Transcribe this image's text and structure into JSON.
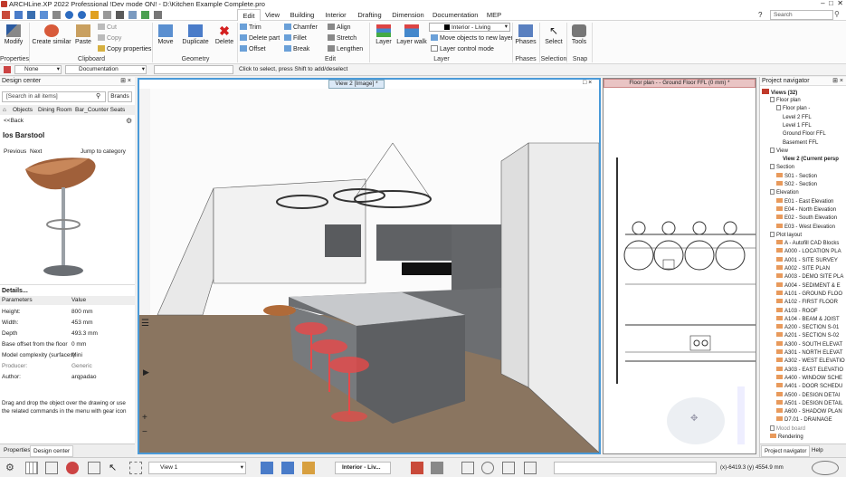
{
  "title": "ARCHLine.XP 2022  Professional !Dev mode ON! - D:\\Kitchen Example Complete.pro",
  "menu": [
    "Edit",
    "View",
    "Building",
    "Interior",
    "Drafting",
    "Dimension",
    "Documentation",
    "MEP"
  ],
  "search_placeholder": "Search",
  "ribbon": {
    "modify": "Modify",
    "create_similar": "Create similar",
    "paste": "Paste",
    "cut": "Cut",
    "copy": "Copy",
    "copy_properties": "Copy properties",
    "move": "Move",
    "duplicate": "Duplicate",
    "delete": "Delete",
    "trim": "Trim",
    "delete_part": "Delete part",
    "offset": "Offset",
    "chamfer": "Chamfer",
    "fillet": "Fillet",
    "break": "Break",
    "align": "Align",
    "stretch": "Stretch",
    "lengthen": "Lengthen",
    "layer": "Layer",
    "layer_walk": "Layer walk",
    "layer_value": "Interior - Living",
    "move_objects": "Move objects to new layer",
    "layer_control": "Layer control mode",
    "phases": "Phases",
    "select": "Select",
    "tools": "Tools",
    "groups": [
      "Properties",
      "Clipboard",
      "Geometry",
      "Edit",
      "Layer",
      "Phases",
      "Selection",
      "Snap"
    ]
  },
  "toolbar2": {
    "line_style": "None",
    "layer": "Documentation",
    "hint": "Click to select, press Shift to add/deselect"
  },
  "design_center": {
    "title": "Design center",
    "search": "[Search in all items]",
    "brands": "Brands",
    "breadcrumb": [
      "Objects",
      "Dining Room",
      "Bar_Counter Seats"
    ],
    "back": "<<Back",
    "item_title": "Ios Barstool",
    "previous": "Previous",
    "next": "Next",
    "jump": "Jump to category",
    "details": "Details...",
    "params_header": [
      "Parameters",
      "Value"
    ],
    "params": [
      [
        "Height:",
        "800 mm"
      ],
      [
        "Width:",
        "453 mm"
      ],
      [
        "Depth",
        "493.3 mm"
      ],
      [
        "Base offset from the floor",
        "0 mm"
      ],
      [
        "Model complexity (surfaces)",
        "Mini"
      ],
      [
        "Producer:",
        "Generic"
      ],
      [
        "Author:",
        "arqpadao"
      ]
    ],
    "help": "Drag and drop the object over the drawing or use the related commands in the menu with gear icon",
    "tabs": [
      "Properties",
      "Design center"
    ]
  },
  "view2_tab": "View 2 [Image] *",
  "floorplan_tab": "Floor plan - - Ground Floor FFL (0 mm) *",
  "navigator": {
    "title": "Project navigator",
    "root": "Views (32)",
    "items": [
      {
        "t": "Floor plan",
        "d": 1,
        "i": "doc"
      },
      {
        "t": "Floor plan -",
        "d": 2,
        "i": "doc"
      },
      {
        "t": "Level 2 FFL",
        "d": 3,
        "i": ""
      },
      {
        "t": "Level 1 FFL",
        "d": 3,
        "i": ""
      },
      {
        "t": "Ground Floor FFL",
        "d": 3,
        "i": ""
      },
      {
        "t": "Basement FFL",
        "d": 3,
        "i": ""
      },
      {
        "t": "View",
        "d": 1,
        "i": "doc"
      },
      {
        "t": "View 2 (Current persp",
        "d": 3,
        "i": "",
        "b": true
      },
      {
        "t": "Section",
        "d": 1,
        "i": "doc"
      },
      {
        "t": "S01 - Section",
        "d": 2,
        "i": "f"
      },
      {
        "t": "S02 - Section",
        "d": 2,
        "i": "f"
      },
      {
        "t": "Elevation",
        "d": 1,
        "i": "doc"
      },
      {
        "t": "E01 - East Elevation",
        "d": 2,
        "i": "f"
      },
      {
        "t": "E04 - North Elevation",
        "d": 2,
        "i": "f"
      },
      {
        "t": "E02 - South Elevation",
        "d": 2,
        "i": "f"
      },
      {
        "t": "E03 - West Elevation",
        "d": 2,
        "i": "f"
      },
      {
        "t": "Plot layout",
        "d": 1,
        "i": "doc"
      },
      {
        "t": "A - Autofill CAD Blocks",
        "d": 2,
        "i": "f"
      },
      {
        "t": "A000 - LOCATION PLA",
        "d": 2,
        "i": "f"
      },
      {
        "t": "A001 - SITE SURVEY",
        "d": 2,
        "i": "f"
      },
      {
        "t": "A002 - SITE PLAN",
        "d": 2,
        "i": "f"
      },
      {
        "t": "A003 - DEMO SITE PLA",
        "d": 2,
        "i": "f"
      },
      {
        "t": "A004 - SEDIMENT & E",
        "d": 2,
        "i": "f"
      },
      {
        "t": "A101 - GROUND FLOO",
        "d": 2,
        "i": "f"
      },
      {
        "t": "A102 - FIRST FLOOR",
        "d": 2,
        "i": "f"
      },
      {
        "t": "A103 - ROOF",
        "d": 2,
        "i": "f"
      },
      {
        "t": "A104 - BEAM & JOIST",
        "d": 2,
        "i": "f"
      },
      {
        "t": "A200 - SECTION S-01",
        "d": 2,
        "i": "f"
      },
      {
        "t": "A201 - SECTION S-02",
        "d": 2,
        "i": "f"
      },
      {
        "t": "A300 - SOUTH ELEVAT",
        "d": 2,
        "i": "f"
      },
      {
        "t": "A301 - NORTH ELEVAT",
        "d": 2,
        "i": "f"
      },
      {
        "t": "A302 - WEST ELEVATIO",
        "d": 2,
        "i": "f"
      },
      {
        "t": "A303 - EAST ELEVATIO",
        "d": 2,
        "i": "f"
      },
      {
        "t": "A400 - WINDOW SCHE",
        "d": 2,
        "i": "f"
      },
      {
        "t": "A401 - DOOR SCHEDU",
        "d": 2,
        "i": "f"
      },
      {
        "t": "A500 - DESIGN DETAI",
        "d": 2,
        "i": "f"
      },
      {
        "t": "A501 - DESIGN DETAIL",
        "d": 2,
        "i": "f"
      },
      {
        "t": "A600 - SHADOW PLAN",
        "d": 2,
        "i": "f"
      },
      {
        "t": "D7.01 - DRAINAGE",
        "d": 2,
        "i": "f"
      },
      {
        "t": "Mood board",
        "d": 1,
        "i": "doc",
        "g": true
      },
      {
        "t": "Rendering",
        "d": 1,
        "i": "f"
      }
    ],
    "tabs": [
      "Project navigator",
      "Help"
    ]
  },
  "status": {
    "view": "View 1",
    "layer": "Interior - Liv...",
    "coords": "(x)-6419.3  (y) 4554.9 mm"
  }
}
